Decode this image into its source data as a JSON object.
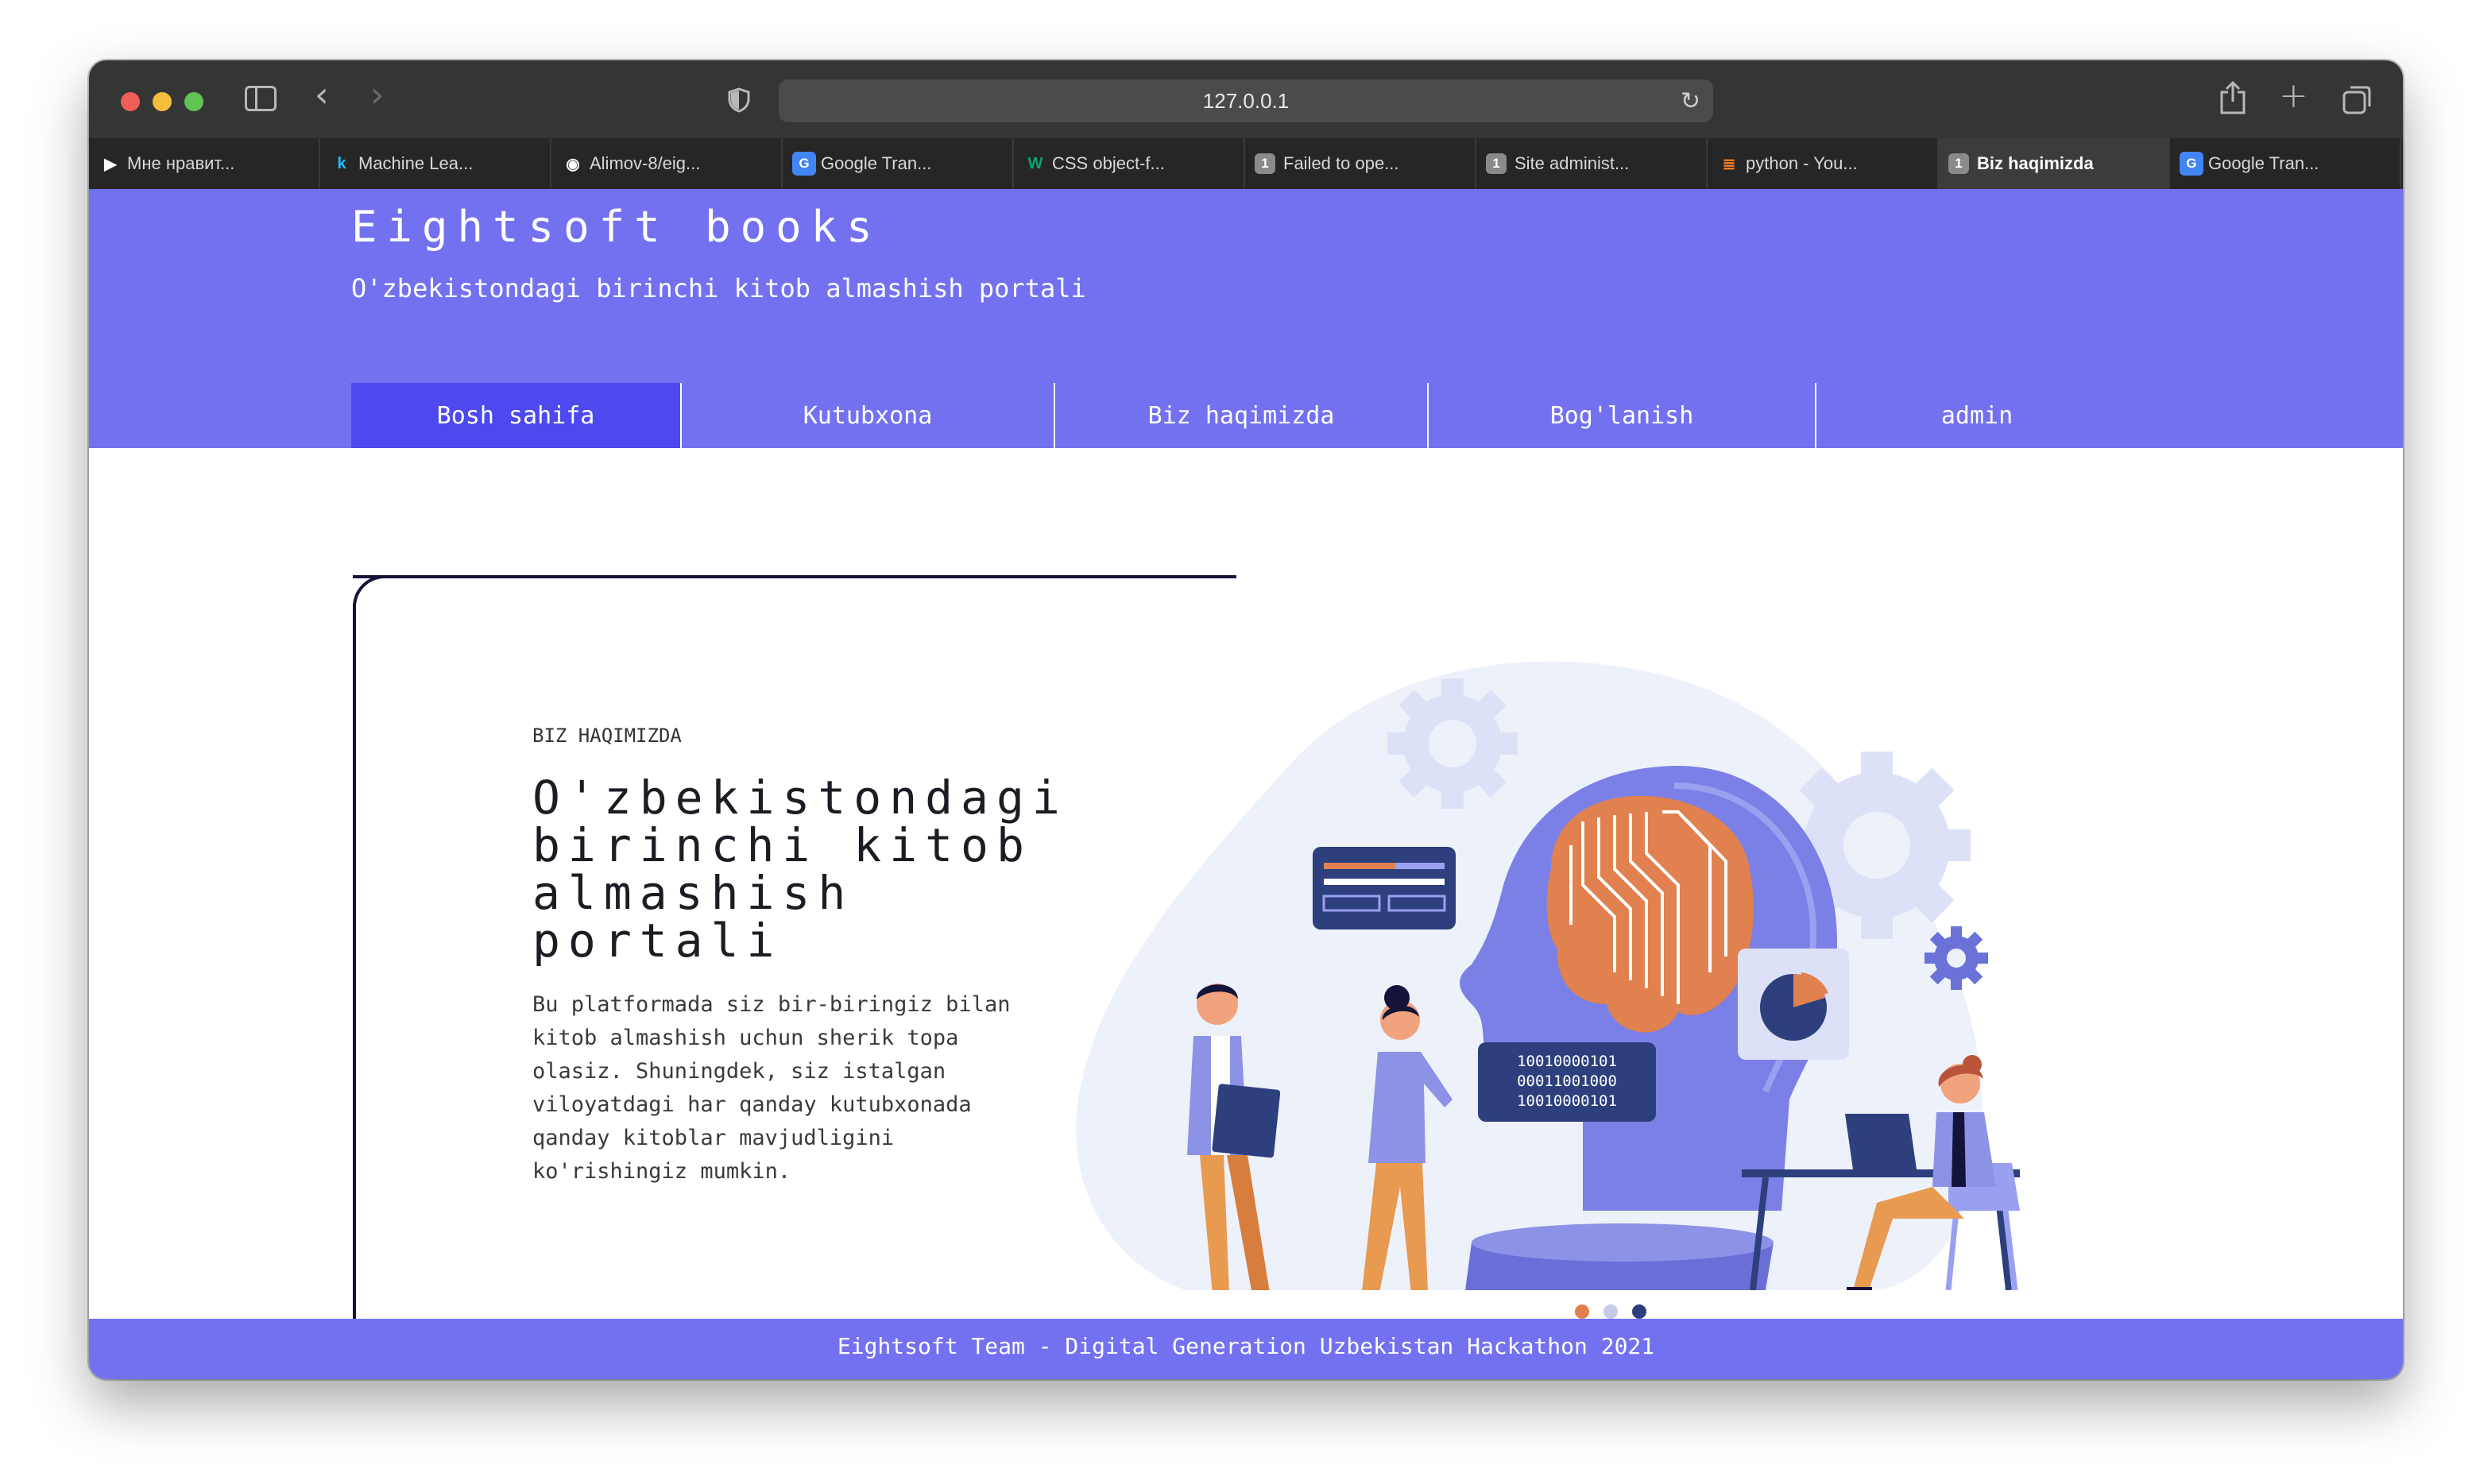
{
  "browser": {
    "url": "127.0.0.1",
    "tabs": [
      {
        "label": "Мне нравит...",
        "icon": "play-icon",
        "color": "#ffffff",
        "glyph": "▶",
        "active": false
      },
      {
        "label": "Machine Lea...",
        "icon": "kaggle-icon",
        "color": "#20beff",
        "glyph": "k",
        "active": false
      },
      {
        "label": "Alimov-8/eig...",
        "icon": "github-icon",
        "color": "#ffffff",
        "glyph": "◉",
        "active": false
      },
      {
        "label": "Google Tran...",
        "icon": "google-translate-icon",
        "color": "#4285f4",
        "glyph": "G",
        "active": false
      },
      {
        "label": "CSS object-f...",
        "icon": "w3schools-icon",
        "color": "#04aa6d",
        "glyph": "W",
        "active": false
      },
      {
        "label": "Failed to ope...",
        "icon": "number-1-icon",
        "color": "#8a8a8a",
        "glyph": "1",
        "active": false
      },
      {
        "label": "Site administ...",
        "icon": "number-1-icon",
        "color": "#8a8a8a",
        "glyph": "1",
        "active": false
      },
      {
        "label": "python - You...",
        "icon": "stackoverflow-icon",
        "color": "#f48024",
        "glyph": "≣",
        "active": false
      },
      {
        "label": "Biz haqimizda",
        "icon": "number-1-icon",
        "color": "#8a8a8a",
        "glyph": "1",
        "active": true
      },
      {
        "label": "Google Tran...",
        "icon": "google-translate-icon",
        "color": "#4285f4",
        "glyph": "G",
        "active": false
      }
    ]
  },
  "site": {
    "brand": "Eightsoft books",
    "tagline": "O'zbekistondagi birinchi kitob almashish portali",
    "nav": [
      {
        "label": "Bosh sahifa",
        "active": true
      },
      {
        "label": "Kutubxona",
        "active": false
      },
      {
        "label": "Biz haqimizda",
        "active": false
      },
      {
        "label": "Bog'lanish",
        "active": false
      },
      {
        "label": "admin",
        "active": false
      }
    ],
    "accent": "#7371f0",
    "nav_active": "#4d49ef"
  },
  "hero": {
    "eyebrow": "BIZ HAQIMIZDA",
    "title": "O'zbekistondagi birinchi kitob almashish portali",
    "text": "Bu platformada siz bir-biringiz bilan kitob almashish uchun sherik topa olasiz. Shuningdek, siz istalgan viloyatdagi har qanday kutubxonada qanday kitoblar mavjudligini ko'rishingiz mumkin.",
    "binary": [
      "10010000101",
      "00011001000",
      "10010000101"
    ],
    "carousel_active": 2
  },
  "footer": {
    "text": "Eightsoft Team - Digital Generation Uzbekistan Hackathon 2021"
  }
}
